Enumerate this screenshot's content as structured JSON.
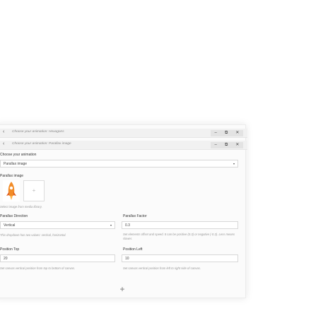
{
  "animations": [
    {
      "label": "Choose your animation: Hexagons"
    },
    {
      "label": "Choose your animation: Parallax image"
    }
  ],
  "window_controls": {
    "minimize": "–",
    "restore": "⧉",
    "close": "✕"
  },
  "choose_animation": {
    "label": "Choose your animation",
    "value": "Parallax image"
  },
  "parallax_image": {
    "label": "Parallax image",
    "add_symbol": "+",
    "hint": "Select image from media library."
  },
  "parallax_direction": {
    "label": "Parallax Direction",
    "value": "Vertical",
    "hint": "This dropdown has two values: vertical, horizontal."
  },
  "parallax_factor": {
    "label": "Parallax Factor",
    "value": "0.3",
    "hint": "Set elements offset and speed. It can be positive (0.3) or negative (-0.3). Less means slower."
  },
  "position_top": {
    "label": "Position Top",
    "value": "20",
    "hint": "Set canvas vertical position from top to bottom of canvas."
  },
  "position_left": {
    "label": "Position Left",
    "value": "10",
    "hint": "Set canvas vertical position from left to right side of canvas."
  },
  "add_button": {
    "symbol": "+"
  },
  "icons": {
    "collapse": "chevron-left-icon",
    "add": "plus-icon"
  },
  "colors": {
    "panel_bg": "#fbfbfb",
    "bar_bg": "#f1f1f1",
    "rocket_orange": "#f28c28"
  }
}
